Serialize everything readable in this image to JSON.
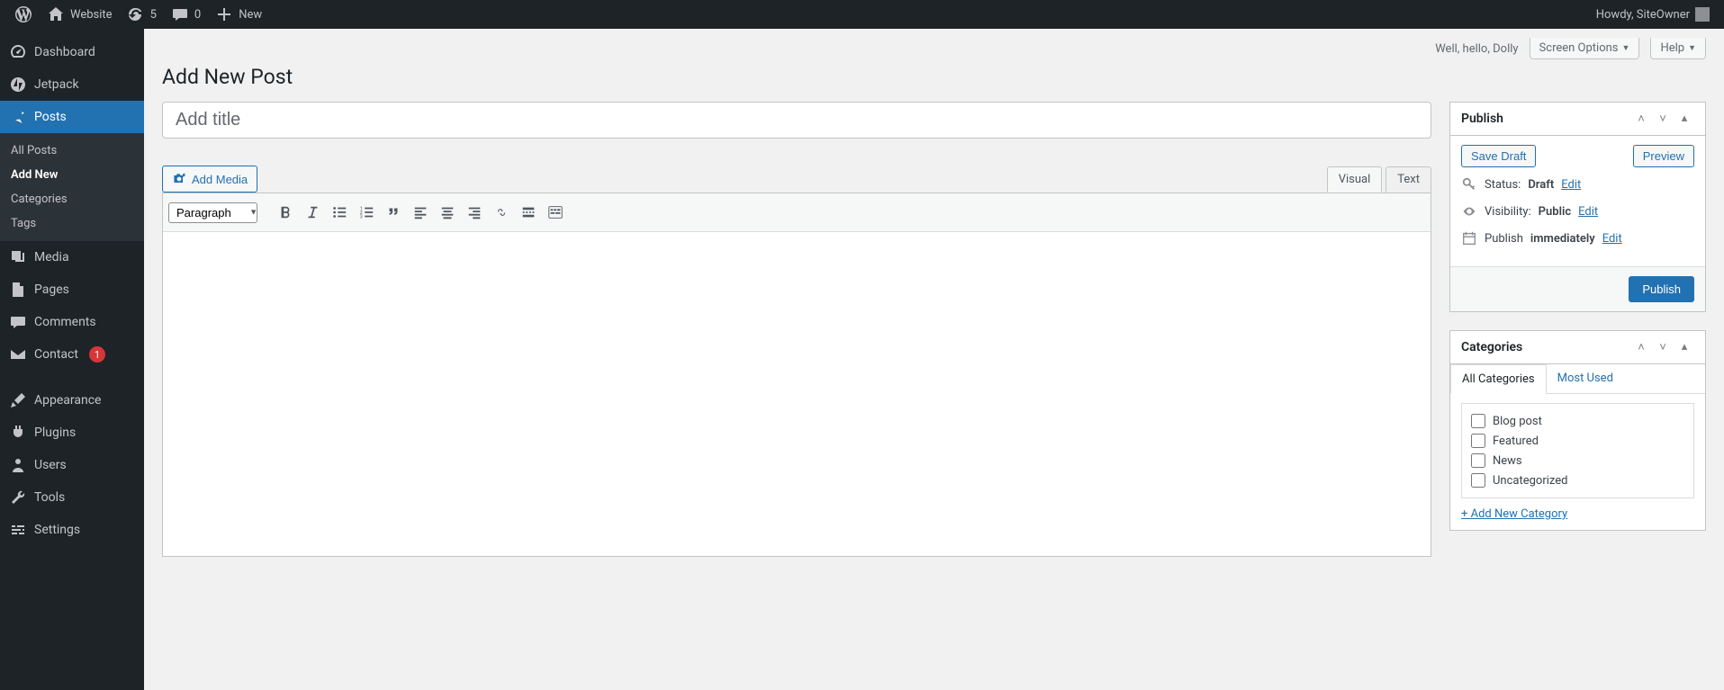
{
  "adminbar": {
    "site_name": "Website",
    "updates_count": "5",
    "comments_count": "0",
    "new_label": "New",
    "greeting": "Howdy, SiteOwner"
  },
  "sidebar": {
    "items": [
      {
        "label": "Dashboard"
      },
      {
        "label": "Jetpack"
      },
      {
        "label": "Posts"
      },
      {
        "label": "Media"
      },
      {
        "label": "Pages"
      },
      {
        "label": "Comments"
      },
      {
        "label": "Contact",
        "badge": "1"
      },
      {
        "label": "Appearance"
      },
      {
        "label": "Plugins"
      },
      {
        "label": "Users"
      },
      {
        "label": "Tools"
      },
      {
        "label": "Settings"
      }
    ],
    "submenu": [
      {
        "label": "All Posts"
      },
      {
        "label": "Add New"
      },
      {
        "label": "Categories"
      },
      {
        "label": "Tags"
      }
    ]
  },
  "top": {
    "dolly": "Well, hello, Dolly",
    "screen_options": "Screen Options",
    "help": "Help"
  },
  "page": {
    "heading": "Add New Post",
    "title_placeholder": "Add title",
    "add_media": "Add Media",
    "tab_visual": "Visual",
    "tab_text": "Text",
    "format_select": "Paragraph"
  },
  "publish": {
    "box_title": "Publish",
    "save_draft": "Save Draft",
    "preview": "Preview",
    "status_label": "Status:",
    "status_value": "Draft",
    "visibility_label": "Visibility:",
    "visibility_value": "Public",
    "publish_label": "Publish",
    "publish_value": "immediately",
    "edit": "Edit",
    "publish_btn": "Publish"
  },
  "categories": {
    "box_title": "Categories",
    "tab_all": "All Categories",
    "tab_most": "Most Used",
    "items": [
      "Blog post",
      "Featured",
      "News",
      "Uncategorized"
    ],
    "add_new": "+ Add New Category"
  }
}
